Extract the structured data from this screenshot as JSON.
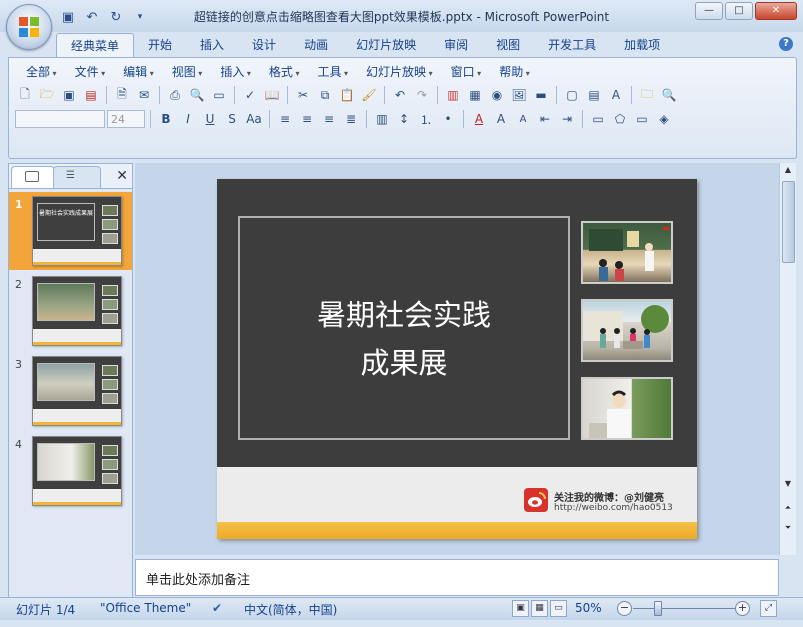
{
  "window": {
    "title": "超链接的创意点击缩略图查看大图ppt效果模板.pptx - Microsoft PowerPoint",
    "minimize": "—",
    "maximize": "□",
    "close": "✕"
  },
  "quick_access": [
    "save-icon",
    "undo-icon",
    "redo-icon",
    "customize-icon"
  ],
  "ribbon": {
    "tabs": [
      "经典菜单",
      "开始",
      "插入",
      "设计",
      "动画",
      "幻灯片放映",
      "审阅",
      "视图",
      "开发工具",
      "加载项"
    ],
    "active_tab": "经典菜单",
    "help": "?",
    "menus": [
      "全部",
      "文件",
      "编辑",
      "视图",
      "插入",
      "格式",
      "工具",
      "幻灯片放映",
      "窗口",
      "帮助"
    ],
    "font_size_value": "24"
  },
  "slide_panel": {
    "close": "✕",
    "thumbnails": [
      {
        "num": "1",
        "title": "暑期社会实践成果展",
        "selected": true
      },
      {
        "num": "2",
        "title": "",
        "selected": false
      },
      {
        "num": "3",
        "title": "",
        "selected": false
      },
      {
        "num": "4",
        "title": "",
        "selected": false
      }
    ]
  },
  "slide": {
    "title_line1": "暑期社会实践",
    "title_line2": "成果展",
    "weibo_line1": "关注我的微博：@刘健亮",
    "weibo_line2": "http://weibo.com/hao0513",
    "colors": {
      "background": "#3d3d3d",
      "footer_bar": "#f2b336",
      "weibo": "#d7322b"
    }
  },
  "notes": {
    "placeholder": "单击此处添加备注"
  },
  "status": {
    "slide_info": "幻灯片 1/4",
    "theme": "\"Office Theme\"",
    "language": "中文(简体，中国)",
    "zoom": "50%",
    "zoom_minus": "−",
    "zoom_plus": "+"
  }
}
